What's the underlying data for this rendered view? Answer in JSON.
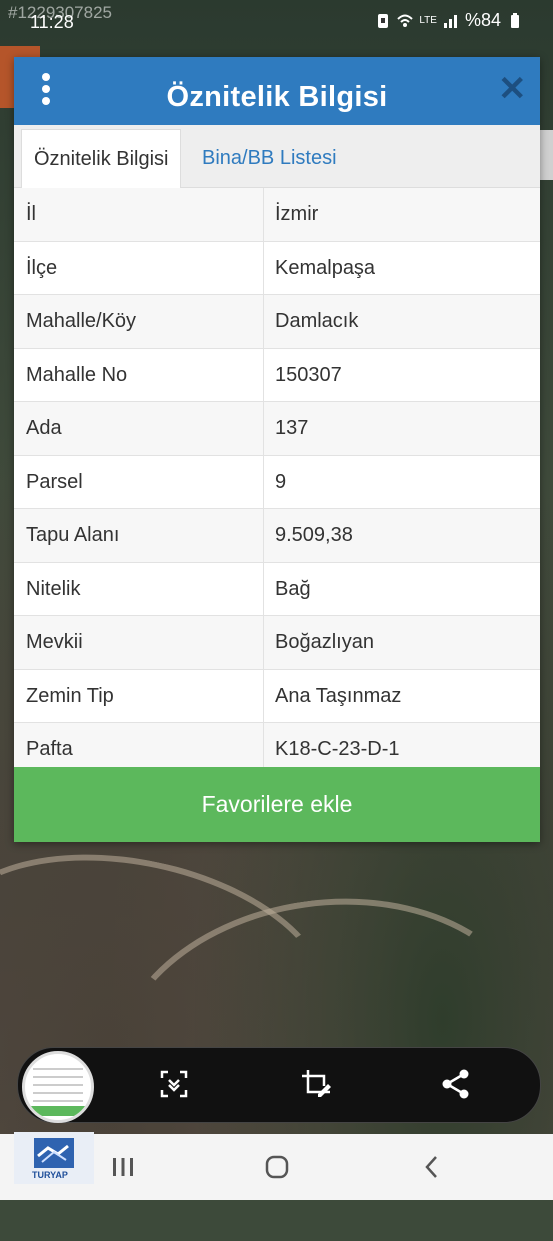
{
  "status_bar": {
    "watermark": "#1229307825",
    "time": "11:28",
    "battery": "%84",
    "network": "LTE"
  },
  "dialog": {
    "title": "Öznitelik Bilgisi",
    "tabs": [
      {
        "label": "Öznitelik Bilgisi",
        "active": true
      },
      {
        "label": "Bina/BB Listesi",
        "active": false
      }
    ],
    "rows": [
      {
        "label": "İl",
        "value": "İzmir"
      },
      {
        "label": "İlçe",
        "value": "Kemalpaşa"
      },
      {
        "label": "Mahalle/Köy",
        "value": "Damlacık"
      },
      {
        "label": "Mahalle No",
        "value": "150307"
      },
      {
        "label": "Ada",
        "value": "137"
      },
      {
        "label": "Parsel",
        "value": "9"
      },
      {
        "label": "Tapu Alanı",
        "value": "9.509,38"
      },
      {
        "label": "Nitelik",
        "value": "Bağ"
      },
      {
        "label": "Mevkii",
        "value": "Boğazlıyan"
      },
      {
        "label": "Zemin Tip",
        "value": "Ana Taşınmaz"
      },
      {
        "label": "Pafta",
        "value": "K18-C-23-D-1"
      }
    ],
    "favorite_button": "Favorilere ekle"
  },
  "screenshot_toolbar": {
    "icons": [
      "scroll-capture-icon",
      "crop-edit-icon",
      "share-icon"
    ]
  },
  "logo": {
    "text": "TURYAP"
  },
  "colors": {
    "header": "#2f7bbf",
    "favorite": "#5cb85c",
    "tab_link": "#2f7bbf"
  }
}
